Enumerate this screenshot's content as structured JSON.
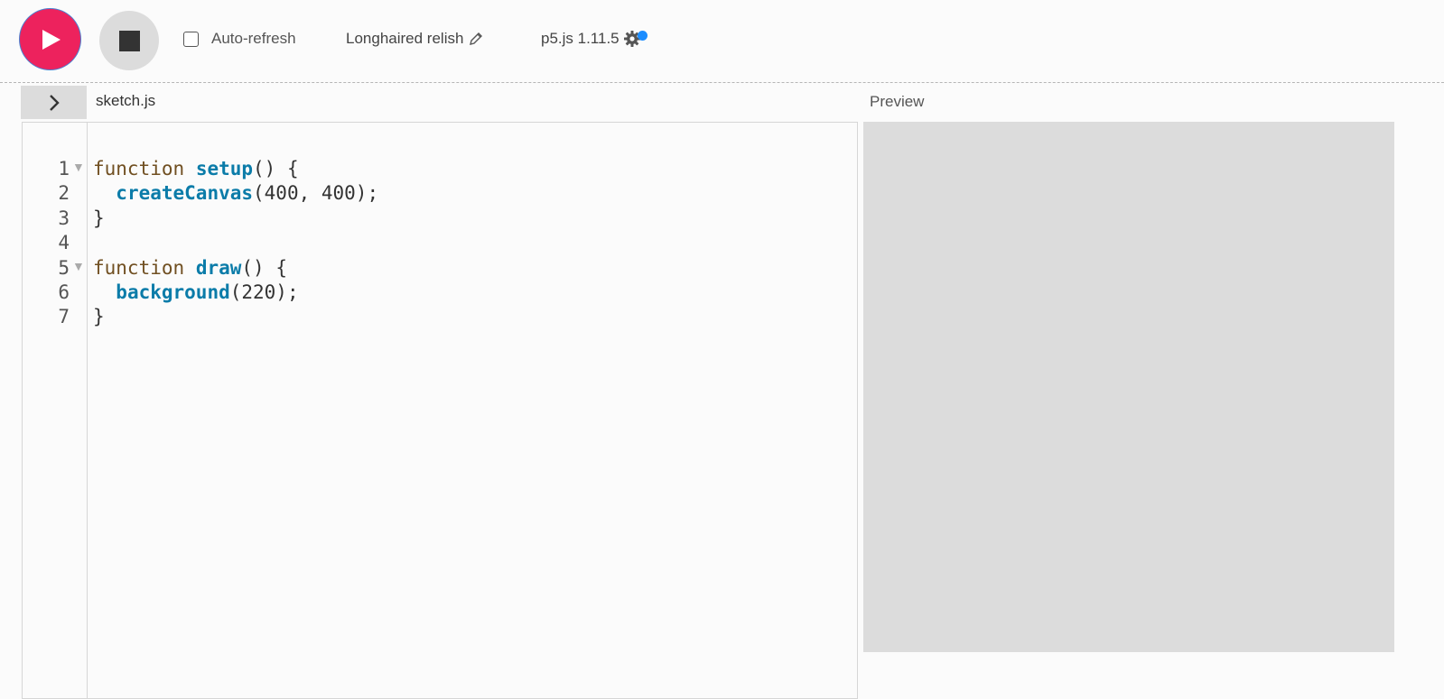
{
  "toolbar": {
    "play_label": "Play",
    "stop_label": "Stop",
    "auto_refresh_label": "Auto-refresh",
    "auto_refresh_checked": false,
    "sketch_name": "Longhaired relish",
    "version": "p5.js 1.11.5",
    "accent_color": "#ed225d",
    "notification_dot_color": "#1a8cff"
  },
  "editor": {
    "file_name": "sketch.js",
    "lines": [
      {
        "num": "1",
        "fold": true,
        "tokens": [
          {
            "t": "function",
            "c": "kw"
          },
          {
            "t": " "
          },
          {
            "t": "setup",
            "c": "fn"
          },
          {
            "t": "() {"
          }
        ]
      },
      {
        "num": "2",
        "fold": false,
        "tokens": [
          {
            "t": "  "
          },
          {
            "t": "createCanvas",
            "c": "fn"
          },
          {
            "t": "(400, 400);"
          }
        ]
      },
      {
        "num": "3",
        "fold": false,
        "tokens": [
          {
            "t": "}"
          }
        ]
      },
      {
        "num": "4",
        "fold": false,
        "tokens": [
          {
            "t": ""
          }
        ]
      },
      {
        "num": "5",
        "fold": true,
        "tokens": [
          {
            "t": "function",
            "c": "kw"
          },
          {
            "t": " "
          },
          {
            "t": "draw",
            "c": "fn"
          },
          {
            "t": "() {"
          }
        ]
      },
      {
        "num": "6",
        "fold": false,
        "tokens": [
          {
            "t": "  "
          },
          {
            "t": "background",
            "c": "fn"
          },
          {
            "t": "(220);"
          }
        ]
      },
      {
        "num": "7",
        "fold": false,
        "tokens": [
          {
            "t": "}"
          }
        ]
      }
    ]
  },
  "preview": {
    "label": "Preview",
    "canvas_color": "#dcdcdc"
  }
}
